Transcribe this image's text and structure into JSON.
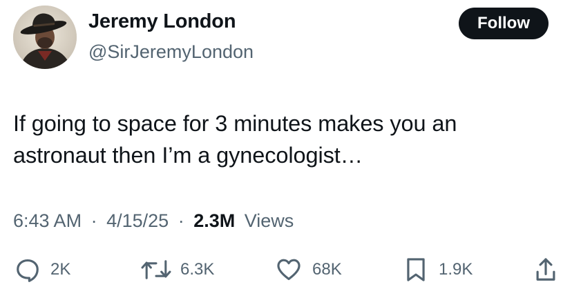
{
  "author": {
    "name": "Jeremy London",
    "handle": "@SirJeremyLondon"
  },
  "follow_label": "Follow",
  "tweet": {
    "line1": "If going to space for 3 minutes makes you an",
    "line2": "astronaut then I’m a gynecologist…"
  },
  "meta": {
    "time": "6:43 AM",
    "date": "4/15/25",
    "separator": "·",
    "views_count": "2.3M",
    "views_label": "Views"
  },
  "actions": {
    "replies": "2K",
    "reposts": "6.3K",
    "likes": "68K",
    "bookmarks": "1.9K"
  },
  "icons": {
    "reply": "reply-icon",
    "repost": "repost-icon",
    "like": "heart-icon",
    "bookmark": "bookmark-icon",
    "share": "share-icon"
  },
  "colors": {
    "text_primary": "#0f1419",
    "text_secondary": "#536471",
    "follow_bg": "#0f1419",
    "follow_text": "#ffffff"
  }
}
